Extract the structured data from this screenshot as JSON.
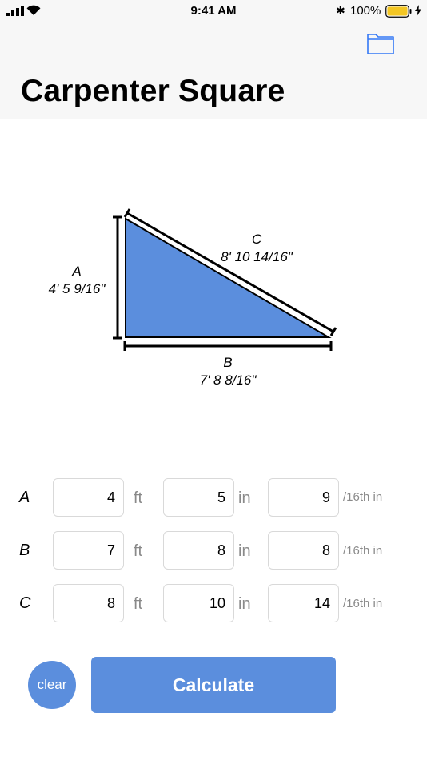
{
  "status": {
    "time": "9:41 AM",
    "battery_percent": "100%",
    "battery_level": 1.0
  },
  "header": {
    "title": "Carpenter Square",
    "folder_icon": "folder-icon"
  },
  "diagram": {
    "a_letter": "A",
    "a_value": "4' 5 9/16\"",
    "b_letter": "B",
    "b_value": "7' 8 8/16\"",
    "c_letter": "C",
    "c_value": "8' 10 14/16\"",
    "fill_color": "#5b8edd"
  },
  "inputs": {
    "rows": [
      {
        "label": "A",
        "ft": "4",
        "in": "5",
        "sixteenths": "9"
      },
      {
        "label": "B",
        "ft": "7",
        "in": "8",
        "sixteenths": "8"
      },
      {
        "label": "C",
        "ft": "8",
        "in": "10",
        "sixteenths": "14"
      }
    ],
    "unit_ft": "ft",
    "unit_in": "in",
    "unit_sixteenths": "/16th in"
  },
  "buttons": {
    "clear": "clear",
    "calculate": "Calculate"
  },
  "colors": {
    "accent": "#5b8edd",
    "icon_blue": "#3478f6"
  }
}
